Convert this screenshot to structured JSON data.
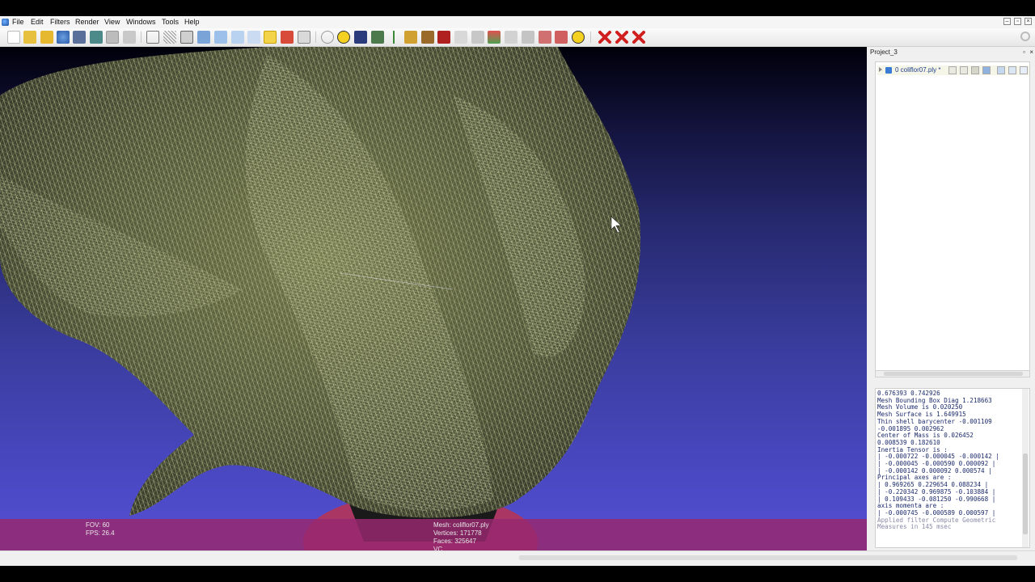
{
  "menu": [
    "File",
    "Edit",
    "Filters",
    "Render",
    "View",
    "Windows",
    "Tools",
    "Help"
  ],
  "window_controls": [
    "–",
    "▫",
    "×"
  ],
  "toolbar_icons": [
    "new-icon",
    "open-icon",
    "open-project-icon",
    "reload-icon",
    "save-icon",
    "snapshot-icon",
    "copy-icon",
    "print-icon",
    "bbox-icon",
    "points-icon",
    "wireframe-icon",
    "hidden-lines-icon",
    "flat-icon",
    "smooth-icon",
    "texture-icon",
    "light-icon",
    "color-icon",
    "measure-icon",
    "trackball-icon",
    "annotation-icon",
    "raster-icon",
    "select-vertex-icon",
    "align-icon",
    "paint-icon",
    "brush-icon",
    "pick-icon",
    "select-faces-icon",
    "select-connected-icon",
    "color-paint-icon",
    "select-area-icon",
    "z-paint-icon",
    "sample-icon",
    "quality-icon",
    "info-icon",
    "delete-vertices-icon",
    "delete-faces-icon",
    "delete-all-icon"
  ],
  "project": {
    "title": "Project_3",
    "layer_name": "0  coliflor07.ply *"
  },
  "hud": {
    "fov_label": "FOV:  60",
    "fps_label": "FPS:   26.4",
    "mesh_label": "Mesh: coliflor07.ply",
    "vertices_label": "Vertices: 171778",
    "faces_label": "Faces: 325647",
    "vc_label": "VC"
  },
  "log_lines": [
    "0.676393 0.742926",
    "Mesh Bounding Box Diag 1.218663",
    "Mesh Volume is 0.020250",
    "Mesh Surface is 1.649915",
    "Thin shell barycenter -0.001109",
    "-0.001895 0.002962",
    "Center of Mass is 0.026452",
    "0.008539 0.182610",
    "Inertia Tensor is :",
    "| -0.000722 -0.000045 -0.000142 |",
    "| -0.000045 -0.000590 0.000092 |",
    "| -0.000142 0.000092 0.000574 |",
    "Principal axes are :",
    "| 0.969265 0.229654 0.088234 |",
    "| -0.220342 0.969875 -0.103884 |",
    "| 0.109433 -0.081250 -0.990668 |",
    "axis momenta are :",
    "| -0.000745 -0.000589 0.000597 |"
  ],
  "log_applied": [
    "Applied filter Compute Geometric",
    "Measures in 145 msec"
  ],
  "colors": {
    "viewport_top": "#00000a",
    "viewport_bottom": "#5550d4",
    "overlay": "#96286e",
    "mesh_wire": "#c8cf9a"
  }
}
